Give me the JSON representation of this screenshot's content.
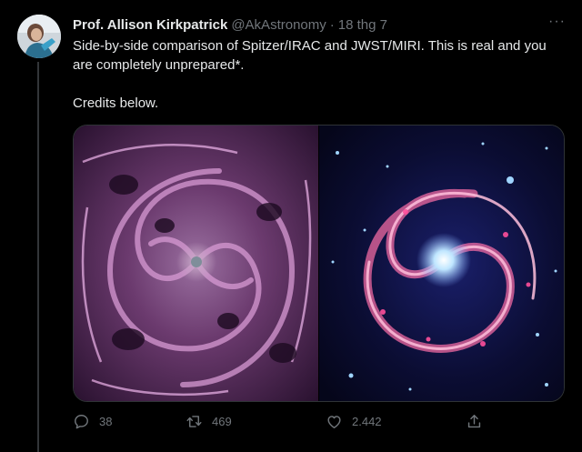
{
  "tweet": {
    "author_name": "Prof. Allison Kirkpatrick",
    "handle": "@AkAstronomy",
    "separator": "·",
    "date": "18 thg 7",
    "more": "···",
    "text_line": "Side-by-side comparison of Spitzer/IRAC and JWST/MIRI. This is real and you are completely unprepared*.",
    "text_credits": "Credits below."
  },
  "actions": {
    "reply_count": "38",
    "retweet_count": "469",
    "like_count": "2.442"
  },
  "colors": {
    "background": "#000000",
    "text": "#e7e9ea",
    "muted": "#71767b",
    "border": "#2f3336"
  }
}
